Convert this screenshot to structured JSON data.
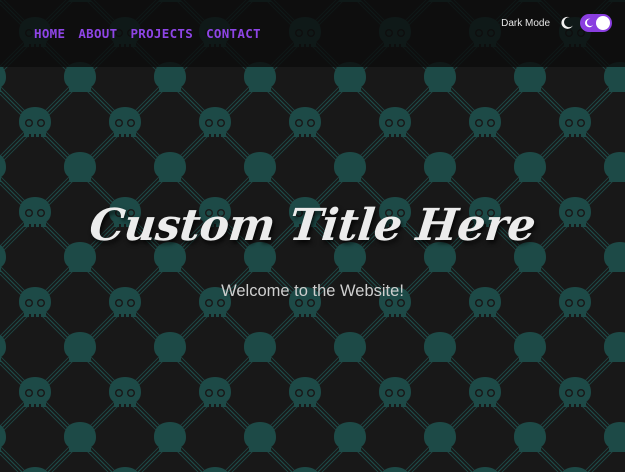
{
  "nav": {
    "items": [
      {
        "label": "HOME"
      },
      {
        "label": "ABOUT"
      },
      {
        "label": "PROJECTS"
      },
      {
        "label": "CONTACT"
      }
    ]
  },
  "theme": {
    "mode_label": "Dark Mode",
    "dark_mode_enabled": true,
    "moon_icon": "moon-icon",
    "accent_color": "#8a3ee0",
    "pattern_color": "#1d4a47",
    "pattern_icon": "skull-icon"
  },
  "hero": {
    "title": "Custom Title Here",
    "subtitle": "Welcome to the Website!"
  }
}
